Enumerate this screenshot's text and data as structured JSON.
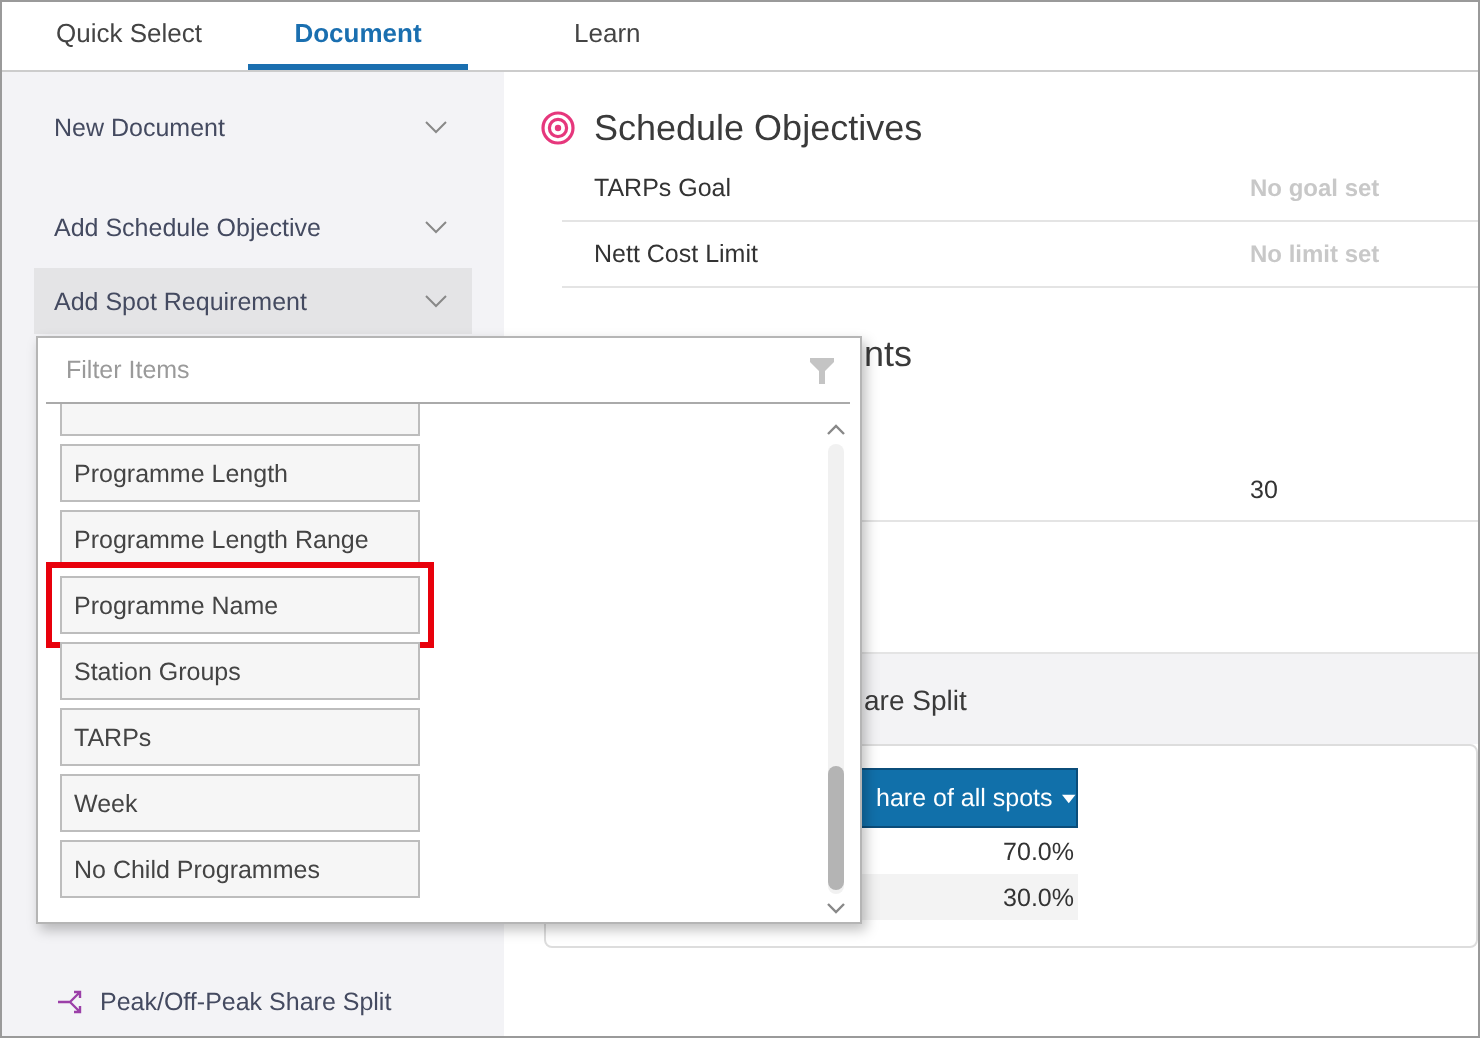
{
  "tabs": [
    {
      "label": "Quick Select",
      "selected": false
    },
    {
      "label": "Document",
      "selected": true
    },
    {
      "label": "Learn",
      "selected": false
    }
  ],
  "sidebar": {
    "items": [
      {
        "label": "New Document",
        "selected": false
      },
      {
        "label": "Add Schedule Objective",
        "selected": false
      },
      {
        "label": "Add Spot Requirement",
        "selected": true
      }
    ],
    "footer_item": {
      "label": "Peak/Off-Peak Share Split"
    }
  },
  "filter_popup": {
    "placeholder": "Filter Items",
    "items": [
      {
        "label": "Programme Length",
        "highlighted": false
      },
      {
        "label": "Programme Length Range",
        "highlighted": false
      },
      {
        "label": "Programme Name",
        "highlighted": true
      },
      {
        "label": "Station Groups",
        "highlighted": false
      },
      {
        "label": "TARPs",
        "highlighted": false
      },
      {
        "label": "Week",
        "highlighted": false
      },
      {
        "label": "No Child Programmes",
        "highlighted": false
      }
    ]
  },
  "schedule_objectives": {
    "title": "Schedule Objectives",
    "rows": [
      {
        "label": "TARPs Goal",
        "value": "No goal set"
      },
      {
        "label": "Nett Cost Limit",
        "value": "No limit set"
      }
    ]
  },
  "spot_requirements": {
    "title": "nts",
    "rows": [
      {
        "value": "30"
      }
    ]
  },
  "share_split": {
    "title": "are Split",
    "column_header": "hare of all spots",
    "rows": [
      {
        "value": "70.0%"
      },
      {
        "value": "30.0%"
      }
    ]
  }
}
